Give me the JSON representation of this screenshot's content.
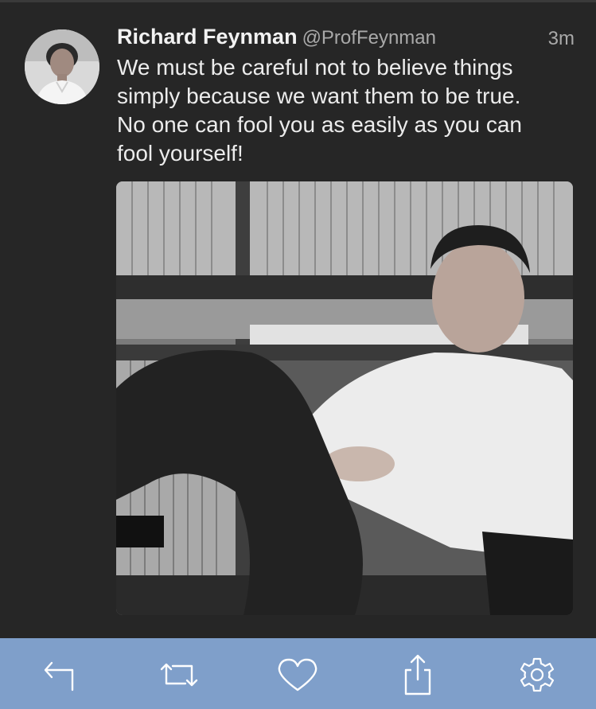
{
  "tweet": {
    "author_name": "Richard Feynman",
    "author_handle": "@ProfFeynman",
    "time_ago": "3m",
    "text": "We must be careful not to believe things\nsimply because we want them to be true.\nNo one can fool you as easily as you can\nfool yourself!",
    "avatar_icon": "avatar-photo",
    "media_icon": "photo"
  },
  "actions": [
    {
      "name": "reply",
      "icon": "reply-icon"
    },
    {
      "name": "retweet",
      "icon": "retweet-icon"
    },
    {
      "name": "like",
      "icon": "heart-icon"
    },
    {
      "name": "share",
      "icon": "share-icon"
    },
    {
      "name": "settings",
      "icon": "gear-icon"
    }
  ],
  "colors": {
    "background": "#262626",
    "action_bar": "#7f9fca",
    "icon": "#ffffff",
    "name": "#f2f2f2",
    "meta": "#a9a9a9"
  }
}
